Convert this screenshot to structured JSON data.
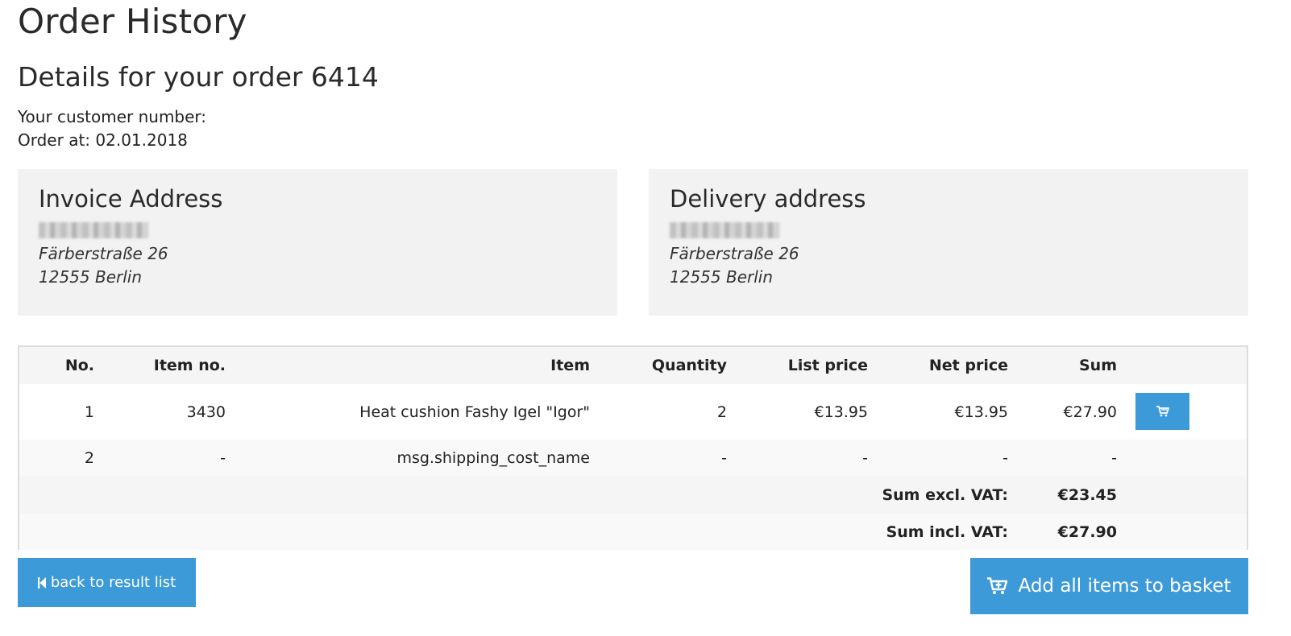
{
  "page": {
    "title": "Order History",
    "order_heading": "Details for your order 6414",
    "customer_number_label": "Your customer number:",
    "order_date_label": "Order at: 02.01.2018"
  },
  "invoice_address": {
    "title": "Invoice Address",
    "street": "Färberstraße 26",
    "city": "12555 Berlin"
  },
  "delivery_address": {
    "title": "Delivery address",
    "street": "Färberstraße 26",
    "city": "12555 Berlin"
  },
  "table": {
    "headers": {
      "no": "No.",
      "item_no": "Item no.",
      "item": "Item",
      "quantity": "Quantity",
      "list_price": "List price",
      "net_price": "Net price",
      "sum": "Sum"
    },
    "rows": [
      {
        "no": "1",
        "item_no": "3430",
        "item": "Heat cushion Fashy Igel \"Igor\"",
        "quantity": "2",
        "list_price": "€13.95",
        "net_price": "€13.95",
        "sum": "€27.90"
      },
      {
        "no": "2",
        "item_no": "-",
        "item": "msg.shipping_cost_name",
        "quantity": "-",
        "list_price": "-",
        "net_price": "-",
        "sum": "-"
      }
    ],
    "totals": {
      "excl_label": "Sum excl. VAT:",
      "excl_value": "€23.45",
      "incl_label": "Sum incl. VAT:",
      "incl_value": "€27.90"
    }
  },
  "buttons": {
    "back_label": "back to result list",
    "add_all_label": "Add all items to basket"
  },
  "colors": {
    "primary": "#3d9ad8",
    "panel_bg": "#f2f2f2",
    "table_border": "#dddddd"
  },
  "icons": {
    "row_cart": "cart-icon",
    "back": "skip-back-icon",
    "add_all": "cart-plus-icon"
  }
}
